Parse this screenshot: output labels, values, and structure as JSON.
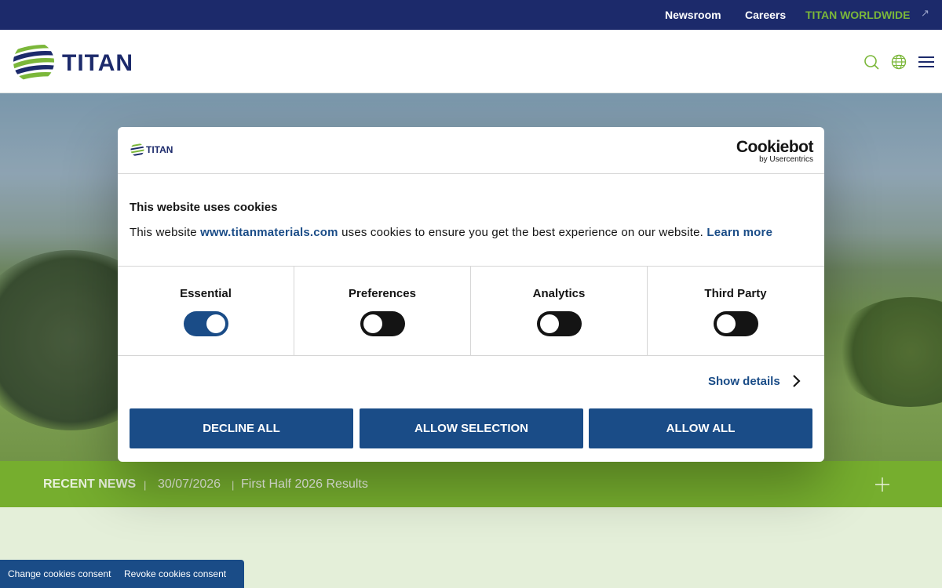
{
  "topbar": {
    "newsroom": "Newsroom",
    "careers": "Careers",
    "worldwide": "TITAN WORLDWIDE",
    "worldwide_icon": "external-arrow-icon"
  },
  "header": {
    "logo_text": "TITAN",
    "icons": [
      "search-icon",
      "globe-icon",
      "menu-icon"
    ],
    "accent_color": "#7bb73a",
    "brand_color": "#1c2a6b"
  },
  "news": {
    "title": "RECENT NEWS",
    "date": "30/07/2026",
    "item": "First Half 2026 Results"
  },
  "cookie_dialog": {
    "logo_text": "TITAN",
    "provider": "Cookiebot",
    "provider_sub": "by Usercentrics",
    "title": "This website uses cookies",
    "text_before": "This website ",
    "site_link": "www.titanmaterials.com",
    "text_after": " uses cookies to ensure you get the best experience on our website. ",
    "learn_more": "Learn more",
    "categories": [
      {
        "label": "Essential",
        "enabled": true
      },
      {
        "label": "Preferences",
        "enabled": false
      },
      {
        "label": "Analytics",
        "enabled": false
      },
      {
        "label": "Third Party",
        "enabled": false
      }
    ],
    "show_details": "Show details",
    "buttons": {
      "decline": "DECLINE ALL",
      "allow_selection": "ALLOW SELECTION",
      "allow_all": "ALLOW ALL"
    },
    "button_color": "#1a4c87"
  },
  "consent_tab": {
    "change": "Change cookies consent",
    "revoke": "Revoke cookies consent"
  }
}
